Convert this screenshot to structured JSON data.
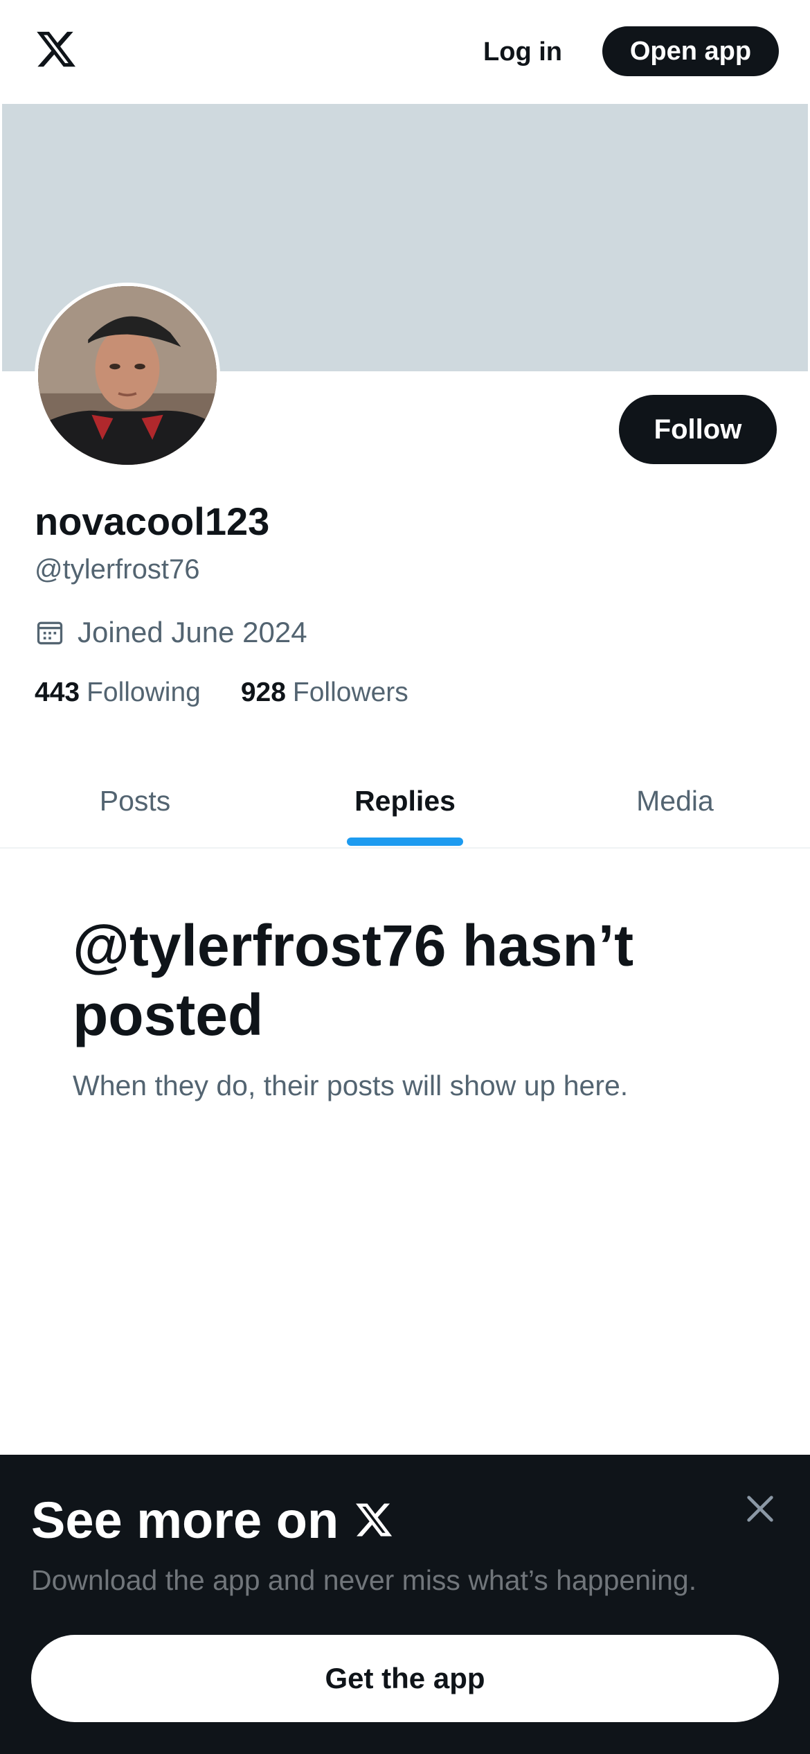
{
  "topbar": {
    "logo_icon": "x-logo-icon",
    "login_label": "Log in",
    "open_app_label": "Open app"
  },
  "profile": {
    "display_name": "novacool123",
    "handle": "@tylerfrost76",
    "joined": "Joined June 2024",
    "following_count": "443",
    "following_label": "Following",
    "followers_count": "928",
    "followers_label": "Followers",
    "follow_label": "Follow",
    "banner_color": "#cfd9de"
  },
  "tabs": [
    {
      "label": "Posts",
      "active": false
    },
    {
      "label": "Replies",
      "active": true
    },
    {
      "label": "Media",
      "active": false
    }
  ],
  "empty_state": {
    "title": "@tylerfrost76 hasn’t posted",
    "subtitle": "When they do, their posts will show up here."
  },
  "sheet": {
    "title": "See more on",
    "subtitle": "Download the app and never miss what’s happening.",
    "cta_label": "Get the app",
    "close_icon": "close-icon"
  },
  "colors": {
    "accent": "#1d9bf0",
    "text_primary": "#0f1419",
    "text_secondary": "#536471",
    "sheet_bg": "#0f1419"
  }
}
